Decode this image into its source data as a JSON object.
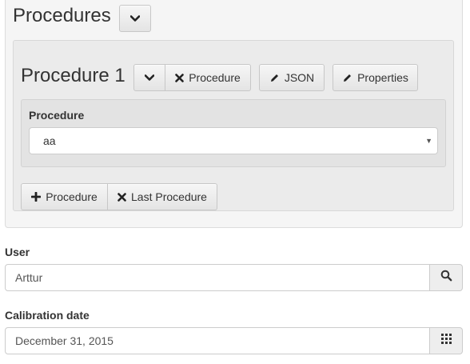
{
  "procedures": {
    "title": "Procedures",
    "toggle_icon": "chevron-down-icon"
  },
  "procedure1": {
    "title": "Procedure 1",
    "collapse_icon": "chevron-down-icon",
    "remove_label": "Procedure",
    "json_label": "JSON",
    "properties_label": "Properties",
    "field_label": "Procedure",
    "field_value": "aa"
  },
  "actions": {
    "add_label": "Procedure",
    "remove_last_label": "Last Procedure"
  },
  "user": {
    "label": "User",
    "value": "Arttur",
    "button_icon": "search-icon"
  },
  "calibration": {
    "label": "Calibration date",
    "value": "December 31, 2015",
    "button_icon": "calendar-grid-icon"
  }
}
